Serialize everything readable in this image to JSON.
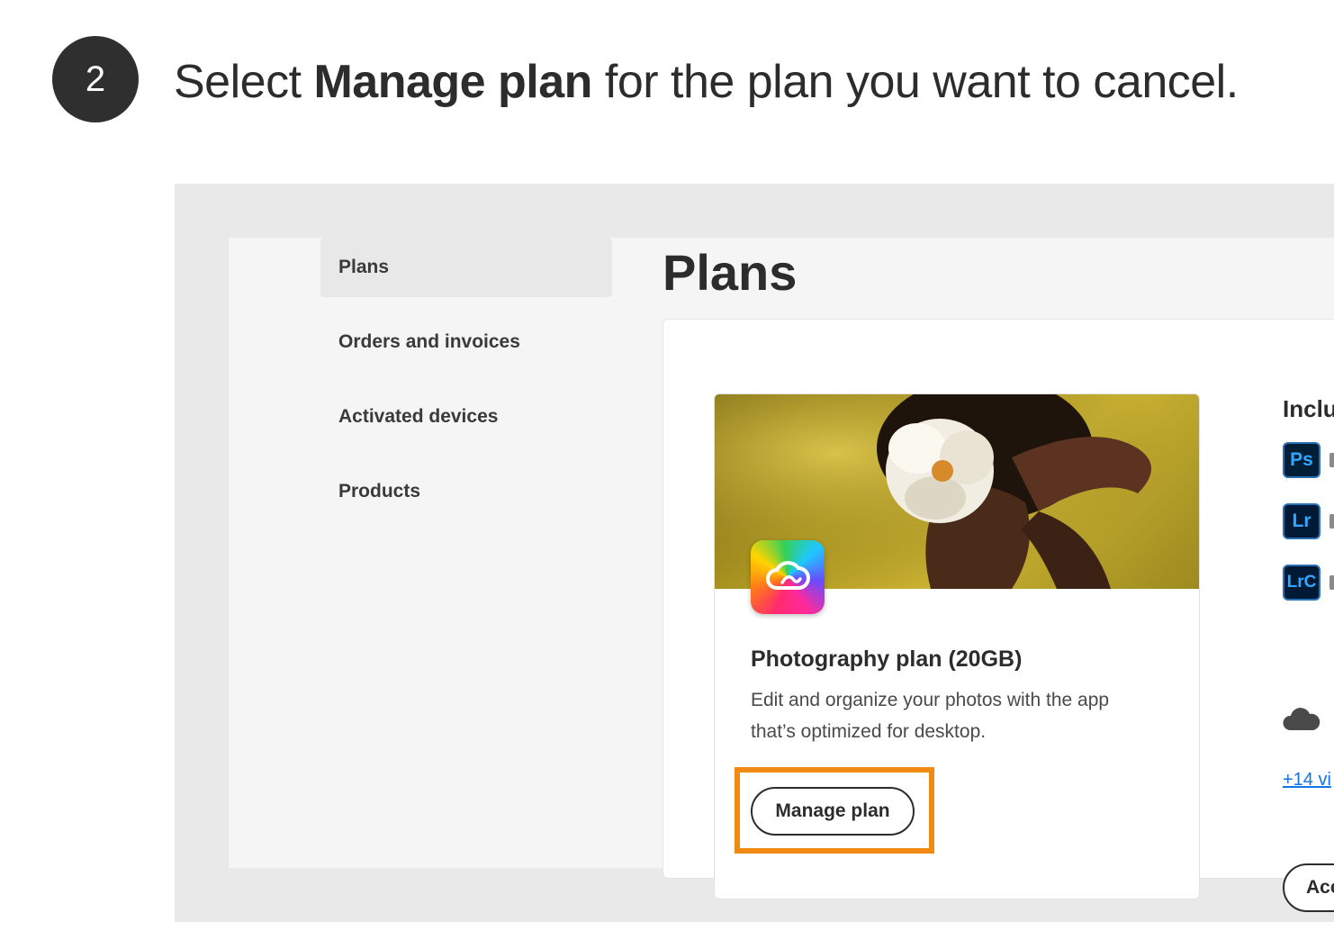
{
  "step": {
    "number": "2",
    "text_before": "Select ",
    "text_bold": "Manage plan",
    "text_after": " for the plan you want to cancel."
  },
  "sidebar": {
    "items": [
      {
        "label": "Plans",
        "active": true
      },
      {
        "label": "Orders and invoices",
        "active": false
      },
      {
        "label": "Activated devices",
        "active": false
      },
      {
        "label": "Products",
        "active": false
      }
    ]
  },
  "main": {
    "title": "Plans",
    "plan_card": {
      "image": "woman-with-white-flower-photo",
      "logo": "creative-cloud-icon",
      "name": "Photography plan (20GB)",
      "description": "Edit and organize your photos with the app that’s optimized for desktop.",
      "manage_label": "Manage plan",
      "highlight_color": "#f08a13"
    },
    "includes": {
      "heading": "Inclu",
      "apps": [
        {
          "icon": "photoshop-icon",
          "abbr": "Ps"
        },
        {
          "icon": "lightroom-icon",
          "abbr": "Lr"
        },
        {
          "icon": "lightroom-classic-icon",
          "abbr": "LrC"
        },
        {
          "icon": "cloud-storage-icon",
          "abbr": ""
        }
      ],
      "more_link": "+14 vi",
      "action_label": "Acc"
    }
  }
}
